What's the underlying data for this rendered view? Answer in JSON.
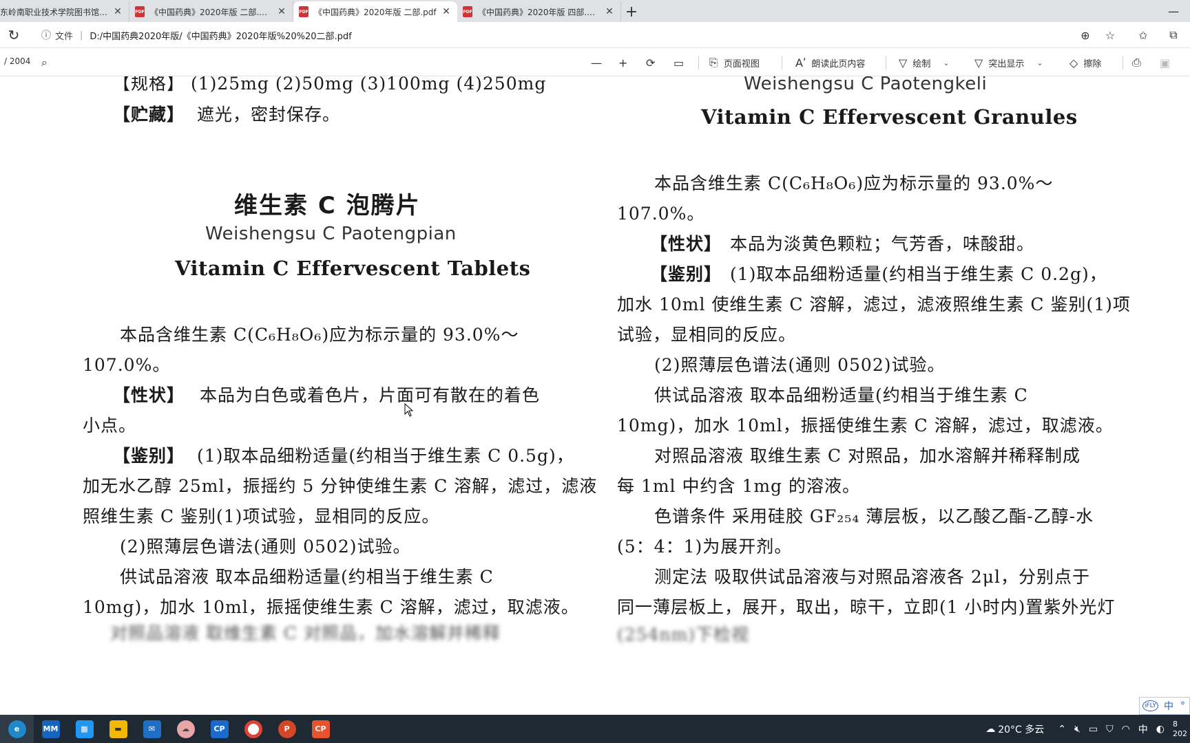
{
  "browser": {
    "tabs": [
      {
        "title": "东岭南职业技术学院图书馆WI",
        "close": "✕"
      },
      {
        "title": "《中国药典》2020年版 二部.pdf",
        "close": "✕"
      },
      {
        "title": "《中国药典》2020年版 二部.pdf",
        "close": "✕",
        "active": true
      },
      {
        "title": "《中国药典》2020年版 四部.pdf",
        "close": "✕"
      }
    ],
    "new_tab": "+",
    "address": {
      "label": "文件",
      "separator": "|",
      "url": "D:/中国药典2020年版/《中国药典》2020年版%20%20二部.pdf"
    }
  },
  "pdf_toolbar": {
    "page_count": "/ 2004",
    "page_view": "页面视图",
    "read_aloud": "朗读此页内容",
    "draw": "绘制",
    "highlight": "突出显示",
    "erase": "擦除"
  },
  "document": {
    "left": {
      "spec_line": "【规格】  (1)25mg  (2)50mg  (3)100mg  (4)250mg",
      "storage_label": "【贮藏】",
      "storage_text": "遮光，密封保存。",
      "title_cn": "维生素 C 泡腾片",
      "title_pinyin": "Weishengsu C Paotengpian",
      "title_en": "Vitamin C Effervescent Tablets",
      "content_line1": "本品含维生素 C(C₆H₈O₆)应为标示量的 93.0%～",
      "content_line2": "107.0%。",
      "xz_label": "【性状】",
      "xz_line1": "本品为白色或着色片，片面可有散在的着色",
      "xz_line2": "小点。",
      "jb_label": "【鉴别】",
      "jb_line1": "(1)取本品细粉适量(约相当于维生素 C 0.5g)，",
      "jb_line2": "加无水乙醇 25ml，振摇约 5 分钟使维生素 C 溶解，滤过，滤液",
      "jb_line3": "照维生素 C 鉴别(1)项试验，显相同的反应。",
      "jb_2": "(2)照薄层色谱法(通则 0502)试验。",
      "gs_line1": "供试品溶液    取本品细粉适量(约相当于维生素 C",
      "gs_line2": "10mg)，加水 10ml，振摇使维生素 C 溶解，滤过，取滤液。",
      "blur_line": "对照品溶液    取维生素 C 对照品，加水溶解并稀释"
    },
    "right": {
      "title_pinyin": "Weishengsu C Paotengkeli",
      "title_en": "Vitamin C Effervescent Granules",
      "content_line1": "本品含维生素 C(C₆H₈O₆)应为标示量的 93.0%～",
      "content_line2": "107.0%。",
      "xz_label": "【性状】",
      "xz_text": "本品为淡黄色颗粒；气芳香，味酸甜。",
      "jb_label": "【鉴别】",
      "jb_line1": "(1)取本品细粉适量(约相当于维生素 C 0.2g)，",
      "jb_line2": "加水 10ml 使维生素 C 溶解，滤过，滤液照维生素 C 鉴别(1)项",
      "jb_line3": "试验，显相同的反应。",
      "jb_2": "(2)照薄层色谱法(通则 0502)试验。",
      "gs_line1": "供试品溶液    取本品细粉适量(约相当于维生素 C",
      "gs_line2": "10mg)，加水 10ml，振摇使维生素 C 溶解，滤过，取滤液。",
      "dz_line1": "对照品溶液    取维生素 C 对照品，加水溶解并稀释制成",
      "dz_line2": "每 1ml 中约含 1mg 的溶液。",
      "sp_line1": "色谱条件    采用硅胶 GF₂₅₄ 薄层板，以乙酸乙酯-乙醇-水",
      "sp_line2": "(5：4：1)为展开剂。",
      "cd_line1": "测定法    吸取供试品溶液与对照品溶液各 2μl，分别点于",
      "cd_line2": "同一薄层板上，展开，取出，晾干，立即(1 小时内)置紫外光灯",
      "blur_line": "(254nm)下检视"
    }
  },
  "ime": {
    "logo": "iFLY",
    "mode": "中",
    "extra": "°"
  },
  "taskbar": {
    "weather": "20°C 多云",
    "ime_lang": "中",
    "time": "8",
    "date": "202"
  }
}
